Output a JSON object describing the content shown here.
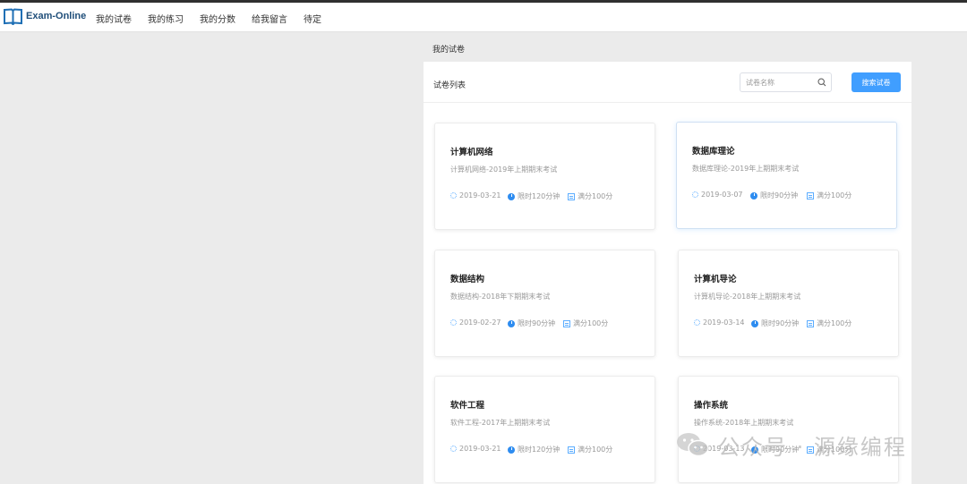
{
  "nav": {
    "brand": "Exam-Online",
    "items": [
      {
        "label": "我的试卷"
      },
      {
        "label": "我的练习"
      },
      {
        "label": "我的分数"
      },
      {
        "label": "给我留言"
      },
      {
        "label": "待定"
      }
    ]
  },
  "breadcrumb": "我的试卷",
  "panel": {
    "title": "试卷列表",
    "search_placeholder": "试卷名称",
    "search_button": "搜索试卷"
  },
  "exams": [
    {
      "title": "计算机网络",
      "desc": "计算机网络-2019年上期期末考试",
      "date": "2019-03-21",
      "time": "限时120分钟",
      "score": "满分100分"
    },
    {
      "title": "数据库理论",
      "desc": "数据库理论-2019年上期期末考试",
      "date": "2019-03-07",
      "time": "限时90分钟",
      "score": "满分100分"
    },
    {
      "title": "数据结构",
      "desc": "数据结构-2018年下期期末考试",
      "date": "2019-02-27",
      "time": "限时90分钟",
      "score": "满分100分"
    },
    {
      "title": "计算机导论",
      "desc": "计算机导论-2018年上期期末考试",
      "date": "2019-03-14",
      "time": "限时90分钟",
      "score": "满分100分"
    },
    {
      "title": "软件工程",
      "desc": "软件工程-2017年上期期末考试",
      "date": "2019-03-21",
      "time": "限时120分钟",
      "score": "满分100分"
    },
    {
      "title": "操作系统",
      "desc": "操作系统-2018年上期期末考试",
      "date": "2019-03-13",
      "time": "限时90分钟",
      "score": "满分100分"
    }
  ],
  "watermark": "公众号 · 源缘编程",
  "icons": {
    "logo": "book-icon",
    "search": "search-icon",
    "date": "calendar-icon",
    "time": "clock-icon",
    "score": "score-icon",
    "watermark_logo": "wechat-icon"
  },
  "colors": {
    "primary": "#409eff",
    "brand": "#1f4e79",
    "accent_icon": "#2d8cf0"
  }
}
